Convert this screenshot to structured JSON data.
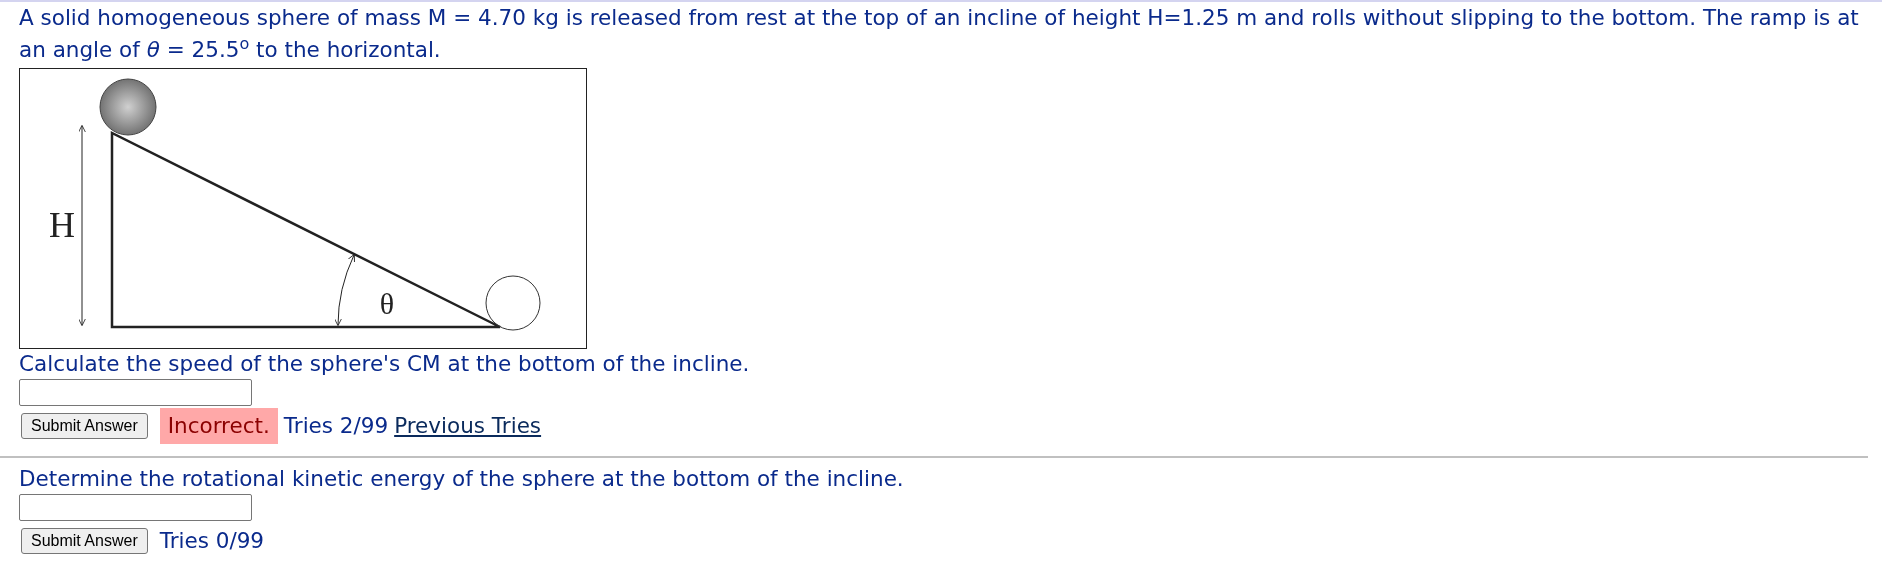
{
  "problem": {
    "text": "A solid homogeneous sphere of mass M = 4.70 kg is released from rest at the top of an incline of height H=1.25 m and rolls without slipping to the bottom. The ramp is at an angle of *θ* = 25.5$^{o}$ to the horizontal.",
    "figure": {
      "height_label": "H",
      "angle_label": "θ"
    }
  },
  "parts": [
    {
      "question": "Calculate the speed of the sphere's CM at the bottom of the incline.",
      "submit_label": "Submit Answer",
      "feedback": {
        "kind": "incorrect",
        "text": "Incorrect."
      },
      "tries": "Tries 2/99",
      "link": "Previous Tries"
    },
    {
      "question": "Determine the rotational kinetic energy of the sphere at the bottom of the incline.",
      "submit_label": "Submit Answer",
      "tries": "Tries 0/99"
    }
  ]
}
